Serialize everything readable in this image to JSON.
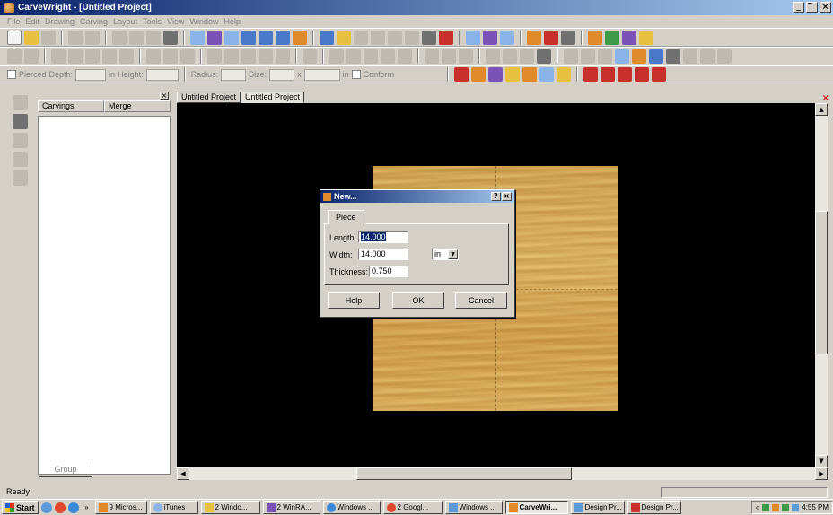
{
  "window": {
    "title": "CarveWright - [Untitled Project]",
    "controls": [
      "_",
      "̅",
      "×"
    ]
  },
  "menu": [
    "File",
    "Edit",
    "Drawing",
    "Carving",
    "Layout",
    "Tools",
    "View",
    "Window",
    "Help"
  ],
  "toolbar3": {
    "pierced_label": "Pierced",
    "depth_label": "Depth:",
    "height_unit": "in",
    "height_label": "Height:",
    "radius_label": "Radius:",
    "size_label": "Size:",
    "x_sep": "x",
    "size_unit": "in",
    "conform_label": "Conform"
  },
  "panel": {
    "columns": [
      "Carvings",
      "Merge"
    ],
    "group_button": "Group",
    "close_glyph": "×"
  },
  "tabs": [
    "Untitled Project",
    "Untitled Project"
  ],
  "tab_close_glyph": "×",
  "dialog": {
    "title": "New...",
    "help_glyph": "?",
    "close_glyph": "×",
    "tab": "Piece",
    "length_label": "Length:",
    "length_value": "14.000",
    "width_label": "Width:",
    "width_value": "14.000",
    "unit": "in",
    "thickness_label": "Thickness:",
    "thickness_value": "0.750",
    "help_button": "Help",
    "ok_button": "OK",
    "cancel_button": "Cancel"
  },
  "status": {
    "text": "Ready"
  },
  "taskbar": {
    "start": "Start",
    "chevron": "»",
    "tasks": [
      "9 Micros...",
      "iTunes",
      "2 Windo...",
      "2 WinRA...",
      "Windows ...",
      "2 Googl...",
      "Windows ...",
      "CarveWri...",
      "Design Pr...",
      "Design Pr..."
    ],
    "tray_chevron": "«",
    "clock": "4:55 PM"
  },
  "colors": {
    "titlebar_start": "#0a246a",
    "titlebar_end": "#a6caf0",
    "canvas": "#000000",
    "wood": "#ddb060",
    "chrome": "#d4d0c8"
  }
}
